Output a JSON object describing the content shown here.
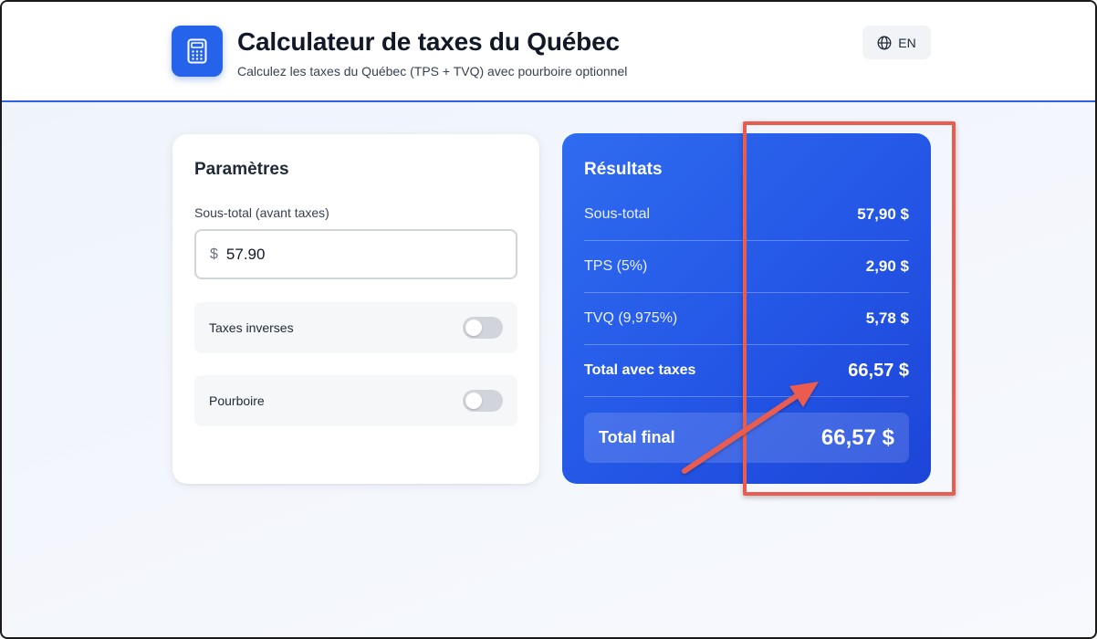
{
  "header": {
    "title": "Calculateur de taxes du Québec",
    "subtitle": "Calculez les taxes du Québec (TPS + TVQ) avec pourboire optionnel",
    "logo_icon": "calculator-icon",
    "lang_icon": "globe-icon",
    "lang_label": "EN"
  },
  "params": {
    "title": "Paramètres",
    "subtotal_label": "Sous-total (avant taxes)",
    "currency_symbol": "$",
    "subtotal_value": "57.90",
    "reverse_tax_label": "Taxes inverses",
    "reverse_tax_on": false,
    "tip_label": "Pourboire",
    "tip_on": false
  },
  "results": {
    "title": "Résultats",
    "rows": [
      {
        "label": "Sous-total",
        "value": "57,90 $"
      },
      {
        "label": "TPS (5%)",
        "value": "2,90 $"
      },
      {
        "label": "TVQ (9,975%)",
        "value": "5,78 $"
      },
      {
        "label": "Total avec taxes",
        "value": "66,57 $"
      }
    ],
    "final_label": "Total final",
    "final_value": "66,57 $"
  },
  "colors": {
    "accent": "#2563eb",
    "annotation": "#e95c4f"
  }
}
